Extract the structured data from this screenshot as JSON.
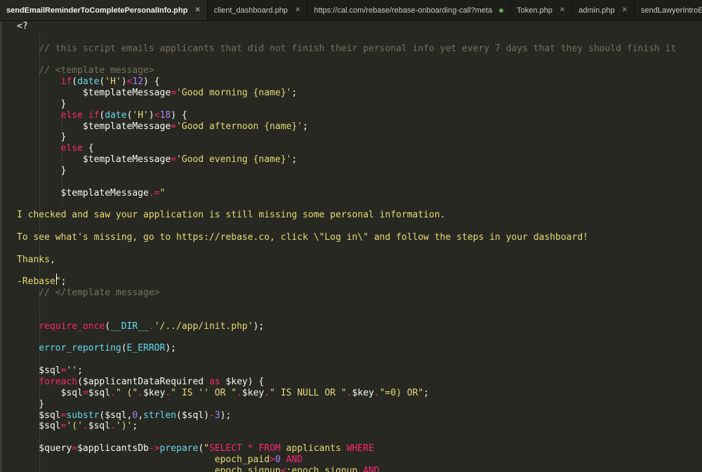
{
  "tabs": [
    {
      "label": "sendEmailReminderToCompletePersonalInfo.php",
      "active": true,
      "state": "close"
    },
    {
      "label": "client_dashboard.php",
      "active": false,
      "state": "close"
    },
    {
      "label": "https://cal.com/rebase/rebase-onboarding-call?meta",
      "active": false,
      "state": "dot"
    },
    {
      "label": "Token.php",
      "active": false,
      "state": "close"
    },
    {
      "label": "admin.php",
      "active": false,
      "state": "close"
    },
    {
      "label": "sendLawyerIntroEmail.php",
      "active": false,
      "state": "close"
    }
  ],
  "colors": {
    "background": "#272822",
    "plain": "#f8f8f2",
    "comment": "#75715e",
    "keyword": "#f92672",
    "function": "#66d9ef",
    "string": "#e6db74",
    "number": "#ae81ff"
  },
  "code_lines": [
    [
      [
        "pl",
        "<?"
      ]
    ],
    [],
    [
      [
        "cm",
        "    // this script emails applicants that did not finish their personal info yet every 7 days that they should finish it"
      ]
    ],
    [],
    [
      [
        "cm",
        "    // <template message>"
      ]
    ],
    [
      [
        "pl",
        "        "
      ],
      [
        "kw",
        "if"
      ],
      [
        "pl",
        "("
      ],
      [
        "fn",
        "date"
      ],
      [
        "pl",
        "("
      ],
      [
        "st",
        "'H'"
      ],
      [
        "pl",
        ")"
      ],
      [
        "op",
        "<"
      ],
      [
        "nm",
        "12"
      ],
      [
        "pl",
        ") {"
      ]
    ],
    [
      [
        "pl",
        "            $templateMessage"
      ],
      [
        "op",
        "="
      ],
      [
        "st",
        "'Good morning {name}'"
      ],
      [
        "pl",
        ";"
      ]
    ],
    [
      [
        "pl",
        "        }"
      ]
    ],
    [
      [
        "pl",
        "        "
      ],
      [
        "kw",
        "else"
      ],
      [
        "pl",
        " "
      ],
      [
        "kw",
        "if"
      ],
      [
        "pl",
        "("
      ],
      [
        "fn",
        "date"
      ],
      [
        "pl",
        "("
      ],
      [
        "st",
        "'H'"
      ],
      [
        "pl",
        ")"
      ],
      [
        "op",
        "<"
      ],
      [
        "nm",
        "18"
      ],
      [
        "pl",
        ") {"
      ]
    ],
    [
      [
        "pl",
        "            $templateMessage"
      ],
      [
        "op",
        "="
      ],
      [
        "st",
        "'Good afternoon {name}'"
      ],
      [
        "pl",
        ";"
      ]
    ],
    [
      [
        "pl",
        "        }"
      ]
    ],
    [
      [
        "pl",
        "        "
      ],
      [
        "kw",
        "else"
      ],
      [
        "pl",
        " {"
      ]
    ],
    [
      [
        "pl",
        "            $templateMessage"
      ],
      [
        "op",
        "="
      ],
      [
        "st",
        "'Good evening {name}'"
      ],
      [
        "pl",
        ";"
      ]
    ],
    [
      [
        "pl",
        "        }"
      ]
    ],
    [],
    [
      [
        "pl",
        "        $templateMessage"
      ],
      [
        "op",
        ".="
      ],
      [
        "st",
        "\""
      ]
    ],
    [],
    [
      [
        "st",
        "I checked and saw your application is still missing some personal information."
      ]
    ],
    [],
    [
      [
        "st",
        "To see what's missing, go to https://rebase.co, click \\\"Log in\\\" and follow the steps in your dashboard!"
      ]
    ],
    [],
    [
      [
        "st",
        "Thanks,"
      ]
    ],
    [],
    [
      [
        "st",
        "-Rebase\""
      ],
      [
        "pl",
        ";"
      ]
    ],
    [
      [
        "cm",
        "    // </template message>"
      ]
    ],
    [],
    [],
    [
      [
        "pl",
        "    "
      ],
      [
        "kw",
        "require_once"
      ],
      [
        "pl",
        "("
      ],
      [
        "fn",
        "__DIR__"
      ],
      [
        "op",
        "."
      ],
      [
        "st",
        "'/../app/init.php'"
      ],
      [
        "pl",
        ");"
      ]
    ],
    [],
    [
      [
        "pl",
        "    "
      ],
      [
        "fn",
        "error_reporting"
      ],
      [
        "pl",
        "("
      ],
      [
        "fn",
        "E_ERROR"
      ],
      [
        "pl",
        ");"
      ]
    ],
    [],
    [
      [
        "pl",
        "    $sql"
      ],
      [
        "op",
        "="
      ],
      [
        "st",
        "''"
      ],
      [
        "pl",
        ";"
      ]
    ],
    [
      [
        "pl",
        "    "
      ],
      [
        "kw",
        "foreach"
      ],
      [
        "pl",
        "($applicantDataRequired "
      ],
      [
        "kw",
        "as"
      ],
      [
        "pl",
        " $key) {"
      ]
    ],
    [
      [
        "pl",
        "        $sql"
      ],
      [
        "op",
        "="
      ],
      [
        "pl",
        "$sql"
      ],
      [
        "op",
        "."
      ],
      [
        "st",
        "\" (\""
      ],
      [
        "op",
        "."
      ],
      [
        "pl",
        "$key"
      ],
      [
        "op",
        "."
      ],
      [
        "st",
        "\" IS '' OR \""
      ],
      [
        "op",
        "."
      ],
      [
        "pl",
        "$key"
      ],
      [
        "op",
        "."
      ],
      [
        "st",
        "\" IS NULL OR \""
      ],
      [
        "op",
        "."
      ],
      [
        "pl",
        "$key"
      ],
      [
        "op",
        "."
      ],
      [
        "st",
        "\"=0) OR\""
      ],
      [
        "pl",
        ";"
      ]
    ],
    [
      [
        "pl",
        "    }"
      ]
    ],
    [
      [
        "pl",
        "    $sql"
      ],
      [
        "op",
        "="
      ],
      [
        "fn",
        "substr"
      ],
      [
        "pl",
        "($sql,"
      ],
      [
        "nm",
        "0"
      ],
      [
        "pl",
        ","
      ],
      [
        "fn",
        "strlen"
      ],
      [
        "pl",
        "($sql)"
      ],
      [
        "op",
        "-"
      ],
      [
        "nm",
        "3"
      ],
      [
        "pl",
        ");"
      ]
    ],
    [
      [
        "pl",
        "    $sql"
      ],
      [
        "op",
        "="
      ],
      [
        "st",
        "'('"
      ],
      [
        "op",
        "."
      ],
      [
        "pl",
        "$sql"
      ],
      [
        "op",
        "."
      ],
      [
        "st",
        "')'"
      ],
      [
        "pl",
        ";"
      ]
    ],
    [],
    [
      [
        "pl",
        "    $query"
      ],
      [
        "op",
        "="
      ],
      [
        "pl",
        "$applicantsDb"
      ],
      [
        "op",
        "->"
      ],
      [
        "fn",
        "prepare"
      ],
      [
        "pl",
        "("
      ],
      [
        "st",
        "\""
      ],
      [
        "kw",
        "SELECT"
      ],
      [
        "st",
        " "
      ],
      [
        "op",
        "*"
      ],
      [
        "st",
        " "
      ],
      [
        "kw",
        "FROM"
      ],
      [
        "st",
        " applicants "
      ],
      [
        "kw",
        "WHERE"
      ]
    ],
    [
      [
        "st",
        "                                    epoch_paid"
      ],
      [
        "op",
        ">"
      ],
      [
        "nm",
        "0"
      ],
      [
        "st",
        " "
      ],
      [
        "kw",
        "AND"
      ]
    ],
    [
      [
        "st",
        "                                    epoch_signup"
      ],
      [
        "op",
        "<"
      ],
      [
        "st",
        ":epoch_signup "
      ],
      [
        "kw",
        "AND"
      ]
    ]
  ]
}
